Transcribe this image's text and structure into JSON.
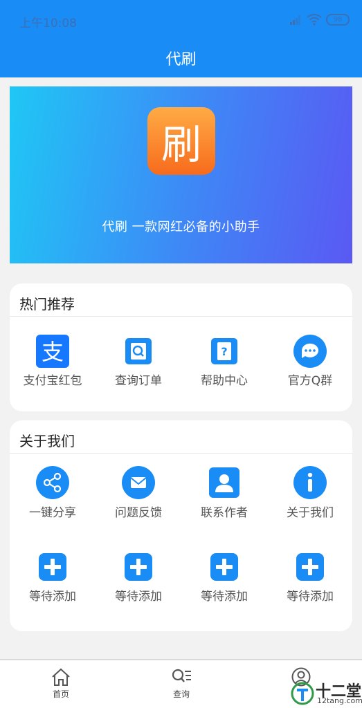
{
  "status_bar": {
    "time": "上午10:08",
    "battery": "98"
  },
  "header": {
    "title": "代刷"
  },
  "banner": {
    "logo_char": "刷",
    "tagline": "代刷   一款网红必备的小助手"
  },
  "hot": {
    "title": "热门推荐",
    "items": [
      {
        "label": "支付宝红包",
        "icon": "alipay-icon"
      },
      {
        "label": "查询订单",
        "icon": "search-order-icon"
      },
      {
        "label": "帮助中心",
        "icon": "help-book-icon"
      },
      {
        "label": "官方Q群",
        "icon": "chat-icon"
      }
    ]
  },
  "about": {
    "title": "关于我们",
    "items": [
      {
        "label": "一键分享",
        "icon": "share-icon"
      },
      {
        "label": "问题反馈",
        "icon": "mail-icon"
      },
      {
        "label": "联系作者",
        "icon": "contact-icon"
      },
      {
        "label": "关于我们",
        "icon": "info-icon"
      },
      {
        "label": "等待添加",
        "icon": "plus-icon"
      },
      {
        "label": "等待添加",
        "icon": "plus-icon"
      },
      {
        "label": "等待添加",
        "icon": "plus-icon"
      },
      {
        "label": "等待添加",
        "icon": "plus-icon"
      }
    ]
  },
  "bottom_nav": [
    {
      "label": "首页",
      "icon": "home-icon"
    },
    {
      "label": "查询",
      "icon": "search-list-icon"
    },
    {
      "label": "",
      "icon": "user-icon"
    }
  ],
  "watermark": {
    "main": "十二堂",
    "sub": "12tang.com"
  },
  "colors": {
    "primary": "#1a8cf5",
    "banner_start": "#1fc7f5",
    "banner_end": "#5a59f3",
    "logo": "#f76b1c"
  }
}
